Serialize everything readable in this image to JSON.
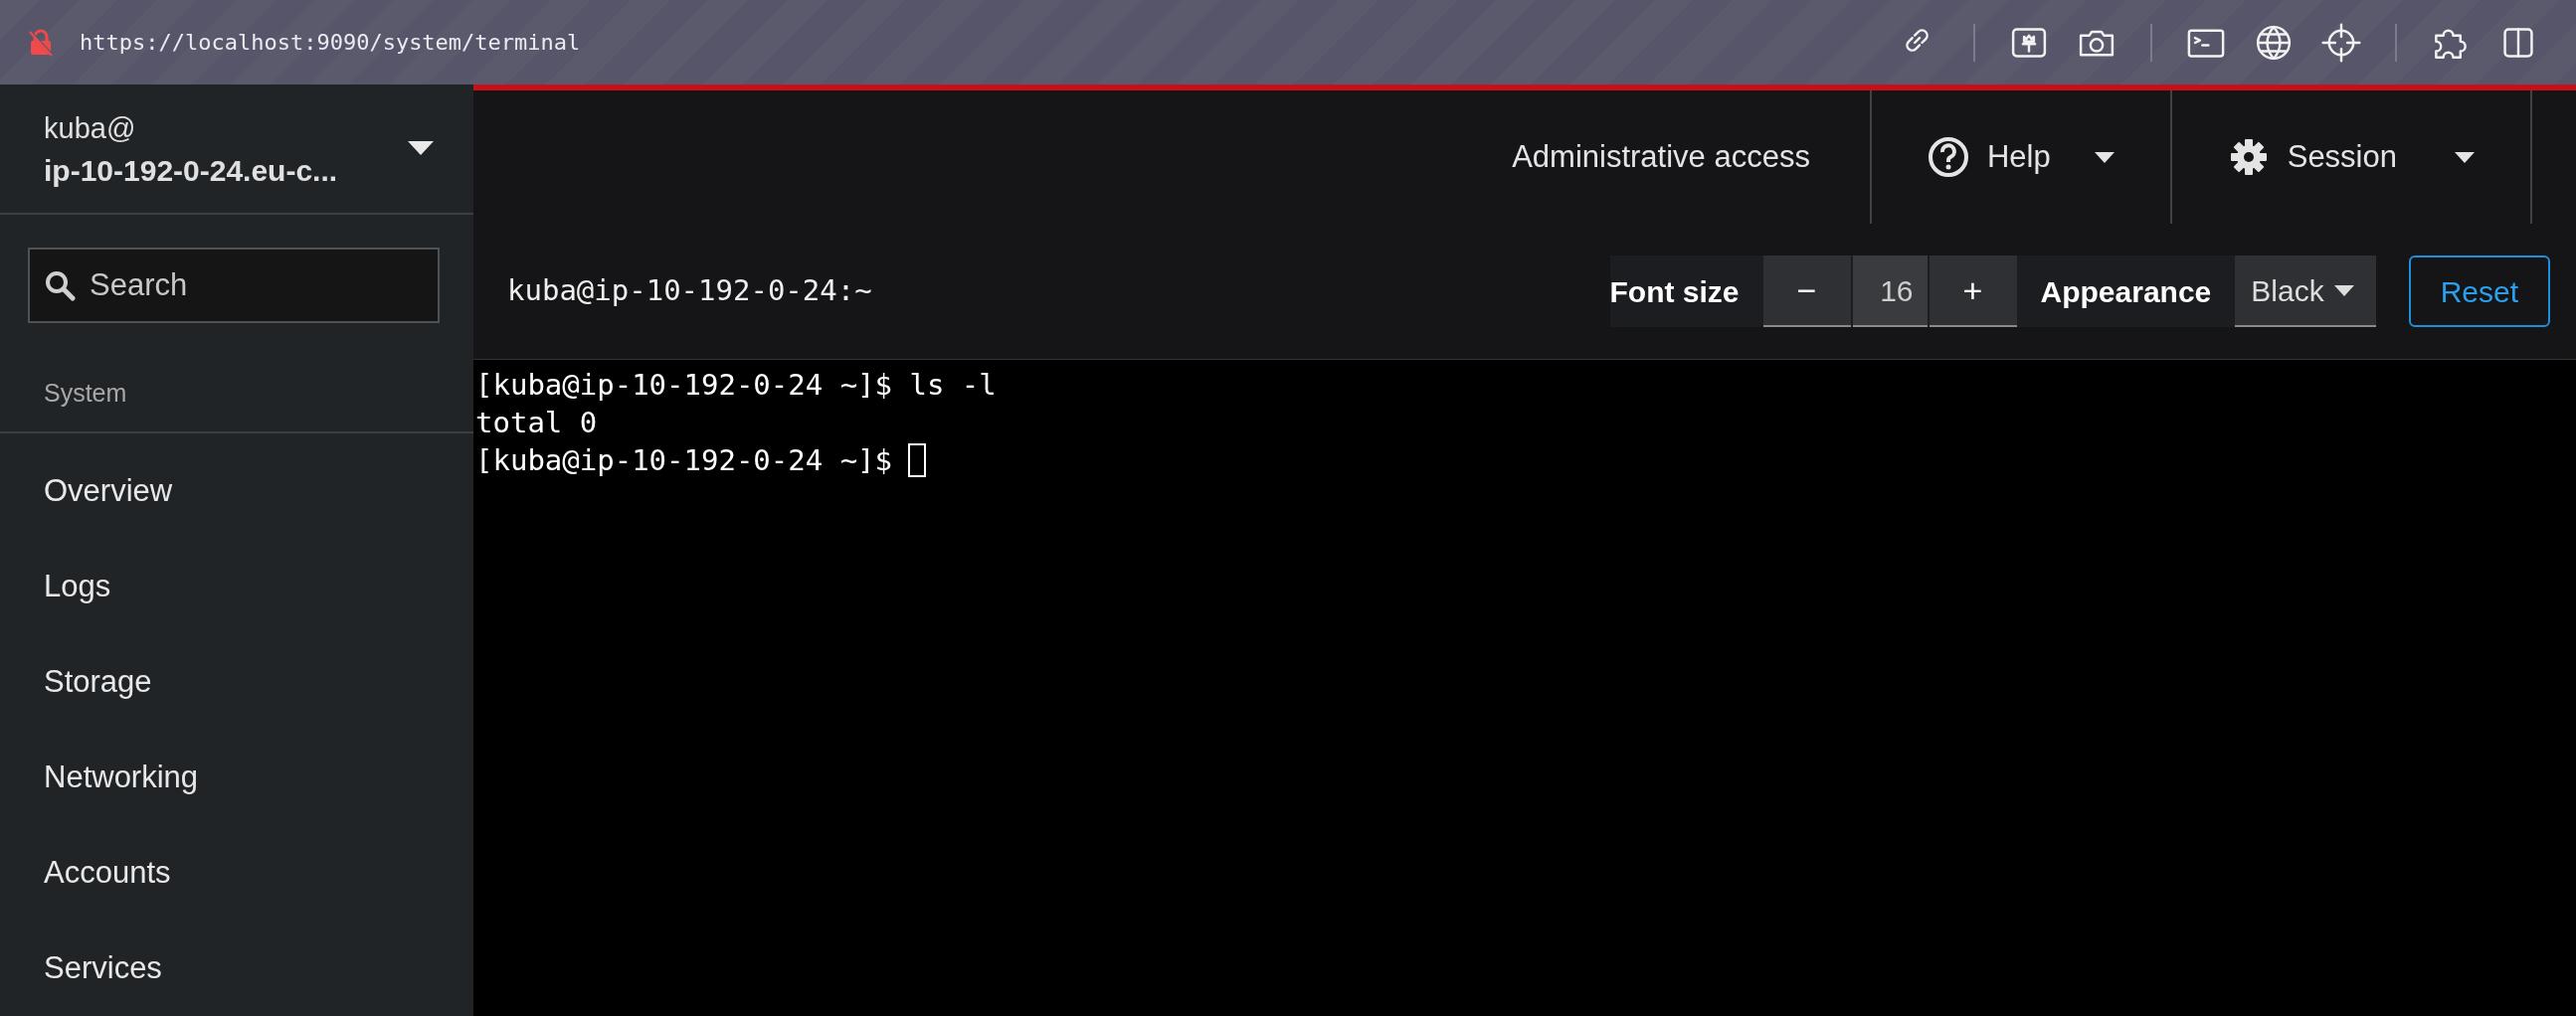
{
  "browser": {
    "url": "https://localhost:9090/system/terminal"
  },
  "sidebar": {
    "user": "kuba@",
    "host": "ip-10-192-0-24.eu-c...",
    "search": {
      "placeholder": "Search"
    },
    "section": "System",
    "items": [
      {
        "label": "Overview"
      },
      {
        "label": "Logs"
      },
      {
        "label": "Storage"
      },
      {
        "label": "Networking"
      },
      {
        "label": "Accounts"
      },
      {
        "label": "Services"
      }
    ]
  },
  "header": {
    "admin": "Administrative access",
    "help": "Help",
    "session": "Session"
  },
  "terminal": {
    "title": "kuba@ip-10-192-0-24:~",
    "font_size_label": "Font size",
    "decrease": "−",
    "font_size": "16",
    "increase": "+",
    "appearance_label": "Appearance",
    "appearance": "Black",
    "reset": "Reset",
    "lines": [
      "[kuba@ip-10-192-0-24 ~]$ ls -l",
      "total 0",
      "[kuba@ip-10-192-0-24 ~]$ "
    ],
    "cursor": true
  }
}
